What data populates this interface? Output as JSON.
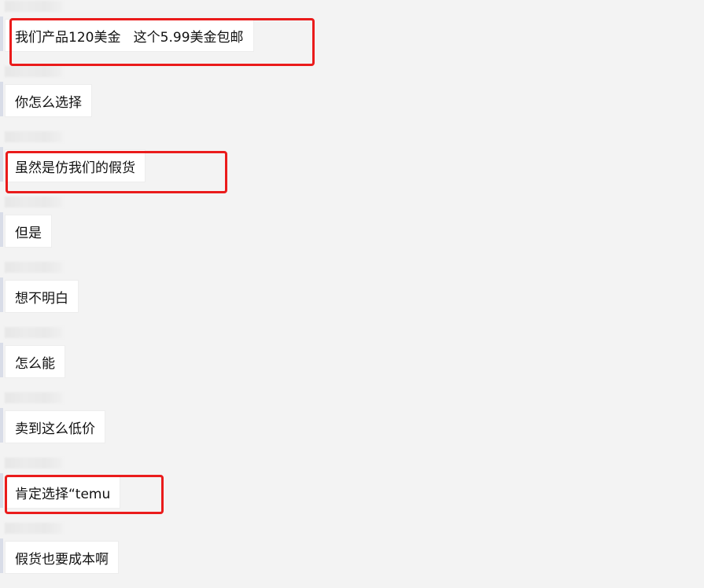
{
  "chat": {
    "messages": [
      {
        "text": "我们产品120美金   这个5.99美金包邮",
        "highlighted": true
      },
      {
        "text": "你怎么选择",
        "highlighted": false
      },
      {
        "text": "虽然是仿我们的假货",
        "highlighted": true
      },
      {
        "text": "但是",
        "highlighted": false
      },
      {
        "text": "想不明白",
        "highlighted": false
      },
      {
        "text": "怎么能",
        "highlighted": false
      },
      {
        "text": "卖到这么低价",
        "highlighted": false
      },
      {
        "text": "肯定选择“temu",
        "highlighted": true
      },
      {
        "text": "假货也要成本啊",
        "highlighted": false
      }
    ]
  },
  "colors": {
    "background": "#f3f3f3",
    "bubble": "#ffffff",
    "highlight_border": "#ea1b1b",
    "text": "#111111"
  }
}
